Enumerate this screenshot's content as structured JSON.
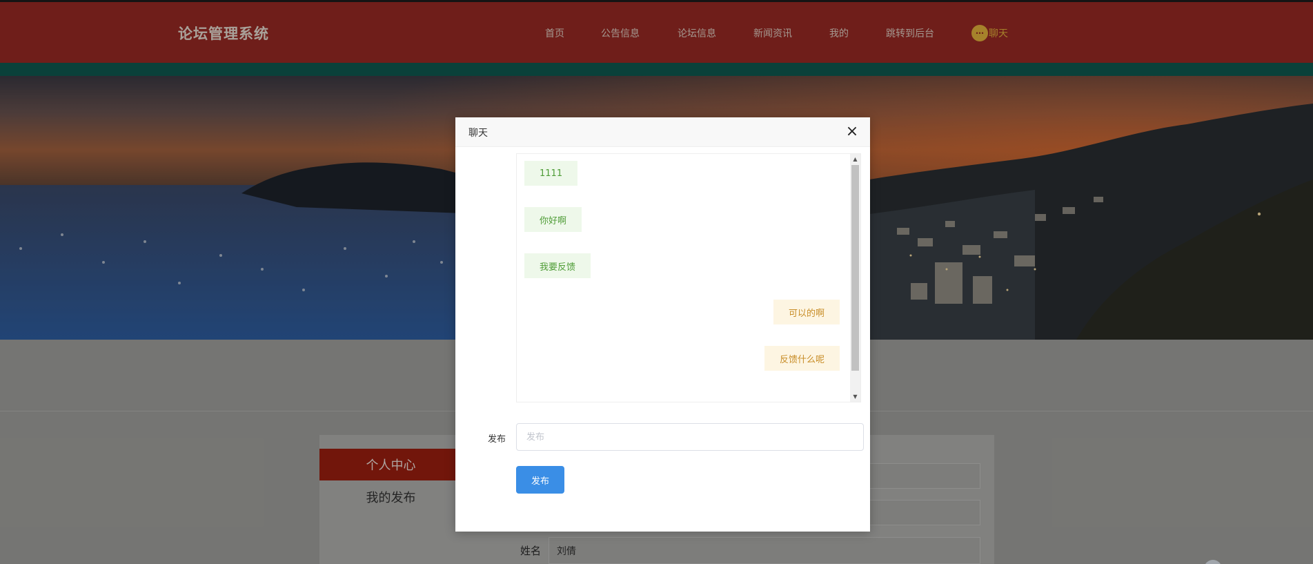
{
  "header": {
    "brand": "论坛管理系统",
    "nav": [
      "首页",
      "公告信息",
      "论坛信息",
      "新闻资讯",
      "我的",
      "跳转到后台"
    ],
    "chat_label": "聊天",
    "chat_icon": "chat-bubble-icon",
    "colors": {
      "bar": "#9a2a25",
      "stripe": "#0e5a51",
      "chat": "#e6b43c"
    }
  },
  "sidebar": {
    "active_item": "个人中心",
    "items": [
      "我的发布"
    ],
    "active_color": "#9e1f10"
  },
  "profile_form": {
    "name_label": "姓名",
    "name_value": "刘倩"
  },
  "chat_dialog": {
    "title": "聊天",
    "close_icon": "close-icon",
    "messages": [
      {
        "side": "left",
        "text": "1111"
      },
      {
        "side": "left",
        "text": "你好啊"
      },
      {
        "side": "left",
        "text": "我要反馈"
      },
      {
        "side": "right",
        "text": "可以的啊"
      },
      {
        "side": "right",
        "text": "反馈什么呢"
      }
    ],
    "compose": {
      "label": "发布",
      "placeholder": "发布",
      "button": "发布"
    },
    "colors": {
      "button": "#3a8ee6",
      "left_bubble": "#eef8ea",
      "right_bubble": "#fdf5e2"
    }
  }
}
